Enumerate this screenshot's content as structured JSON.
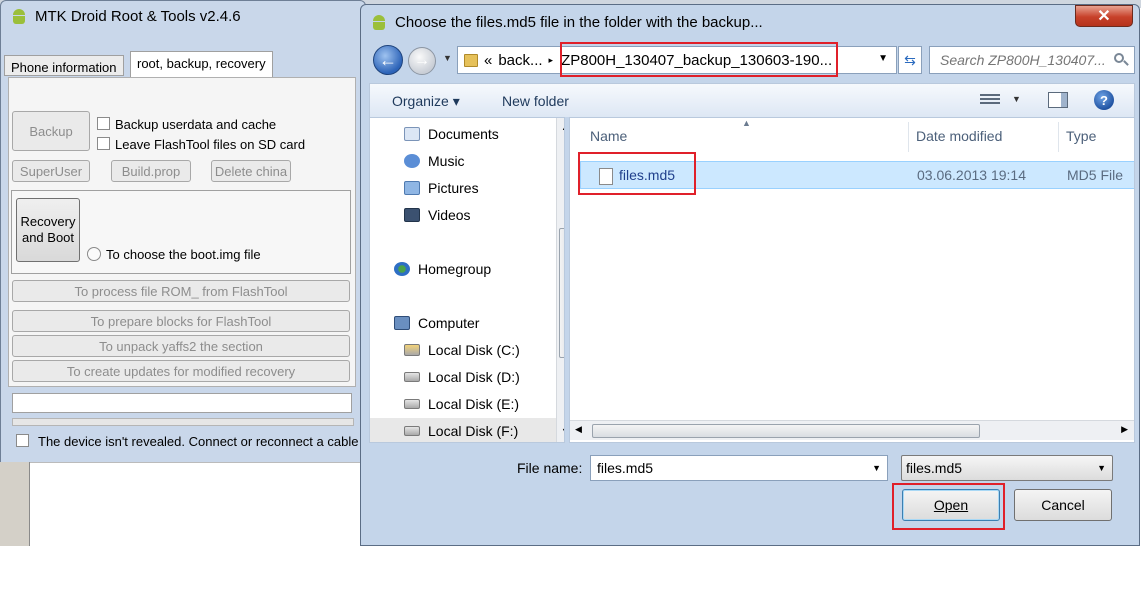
{
  "mtk": {
    "title": "MTK Droid Root & Tools v2.4.6",
    "tabs": [
      "Phone information",
      "root, backup, recovery"
    ],
    "buttons": {
      "backup": "Backup",
      "superuser": "SuperUser",
      "buildprop": "Build.prop",
      "delete_china": "Delete china",
      "recovery_boot_line1": "Recovery",
      "recovery_boot_line2": "and Boot",
      "process_rom": "To process file ROM_ from FlashTool",
      "prepare_blocks": "To prepare blocks for FlashTool",
      "unpack_yaffs": "To unpack yaffs2 the section",
      "create_updates": "To create updates for modified recovery"
    },
    "checkboxes": {
      "backup_userdata": "Backup userdata and cache",
      "leave_flashtool": "Leave FlashTool files on SD card"
    },
    "radio_boot": "To choose the boot.img file",
    "status": "The device isn't revealed. Connect or reconnect a cable"
  },
  "dialog": {
    "title": "Choose the files.md5 file in the folder with the backup...",
    "close_glyph": "✕",
    "address": {
      "overflow": "«",
      "crumb": "back...",
      "current": "ZP800H_130407_backup_130603-190..."
    },
    "search_placeholder": "Search ZP800H_130407...",
    "commands": {
      "organize": "Organize ▾",
      "new_folder": "New folder",
      "help": "?"
    },
    "nav": [
      {
        "label": "Documents",
        "icon": "documents-icon"
      },
      {
        "label": "Music",
        "icon": "music-icon"
      },
      {
        "label": "Pictures",
        "icon": "pictures-icon"
      },
      {
        "label": "Videos",
        "icon": "videos-icon"
      },
      {
        "label": "Homegroup",
        "icon": "homegroup-icon"
      },
      {
        "label": "Computer",
        "icon": "computer-icon"
      },
      {
        "label": "Local Disk (C:)",
        "icon": "disk-icon"
      },
      {
        "label": "Local Disk (D:)",
        "icon": "disk-icon"
      },
      {
        "label": "Local Disk (E:)",
        "icon": "disk-icon"
      },
      {
        "label": "Local Disk (F:)",
        "icon": "disk-icon"
      }
    ],
    "columns": [
      "Name",
      "Date modified",
      "Type"
    ],
    "files": [
      {
        "name": "files.md5",
        "date": "03.06.2013 19:14",
        "type": "MD5 File"
      }
    ],
    "file_name_label": "File name:",
    "file_name_value": "files.md5",
    "file_type_value": "files.md5",
    "open_label": "Open",
    "cancel_label": "Cancel"
  },
  "colors": {
    "highlight": "#e0202a",
    "selection": "#cce8ff",
    "link_text": "#1e395b"
  }
}
